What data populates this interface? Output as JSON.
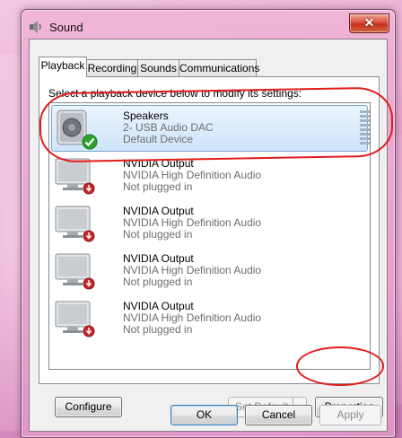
{
  "window": {
    "title": "Sound",
    "close_glyph": "✕"
  },
  "tabs": [
    {
      "label": "Playback",
      "active": true
    },
    {
      "label": "Recording",
      "active": false
    },
    {
      "label": "Sounds",
      "active": false
    },
    {
      "label": "Communications",
      "active": false
    }
  ],
  "playback": {
    "instruction": "Select a playback device below to modify its settings:",
    "devices": [
      {
        "name": "Speakers",
        "line2": "2- USB Audio DAC",
        "status": "Default Device",
        "icon": "speaker-icon",
        "badge": "default-check-icon",
        "selected": true
      },
      {
        "name": "NVIDIA Output",
        "line2": "NVIDIA High Definition Audio",
        "status": "Not plugged in",
        "icon": "monitor-icon",
        "badge": "unplugged-icon",
        "selected": false
      },
      {
        "name": "NVIDIA Output",
        "line2": "NVIDIA High Definition Audio",
        "status": "Not plugged in",
        "icon": "monitor-icon",
        "badge": "unplugged-icon",
        "selected": false
      },
      {
        "name": "NVIDIA Output",
        "line2": "NVIDIA High Definition Audio",
        "status": "Not plugged in",
        "icon": "monitor-icon",
        "badge": "unplugged-icon",
        "selected": false
      },
      {
        "name": "NVIDIA Output",
        "line2": "NVIDIA High Definition Audio",
        "status": "Not plugged in",
        "icon": "monitor-icon",
        "badge": "unplugged-icon",
        "selected": false
      }
    ],
    "configure_label": "Configure",
    "set_default_label": "Set Default",
    "properties_label": "Properties"
  },
  "footer": {
    "ok_label": "OK",
    "cancel_label": "Cancel",
    "apply_label": "Apply"
  },
  "colors": {
    "annotation": "#e11c1c",
    "selection": "#cfe4fa",
    "close_button": "#c3321e"
  }
}
